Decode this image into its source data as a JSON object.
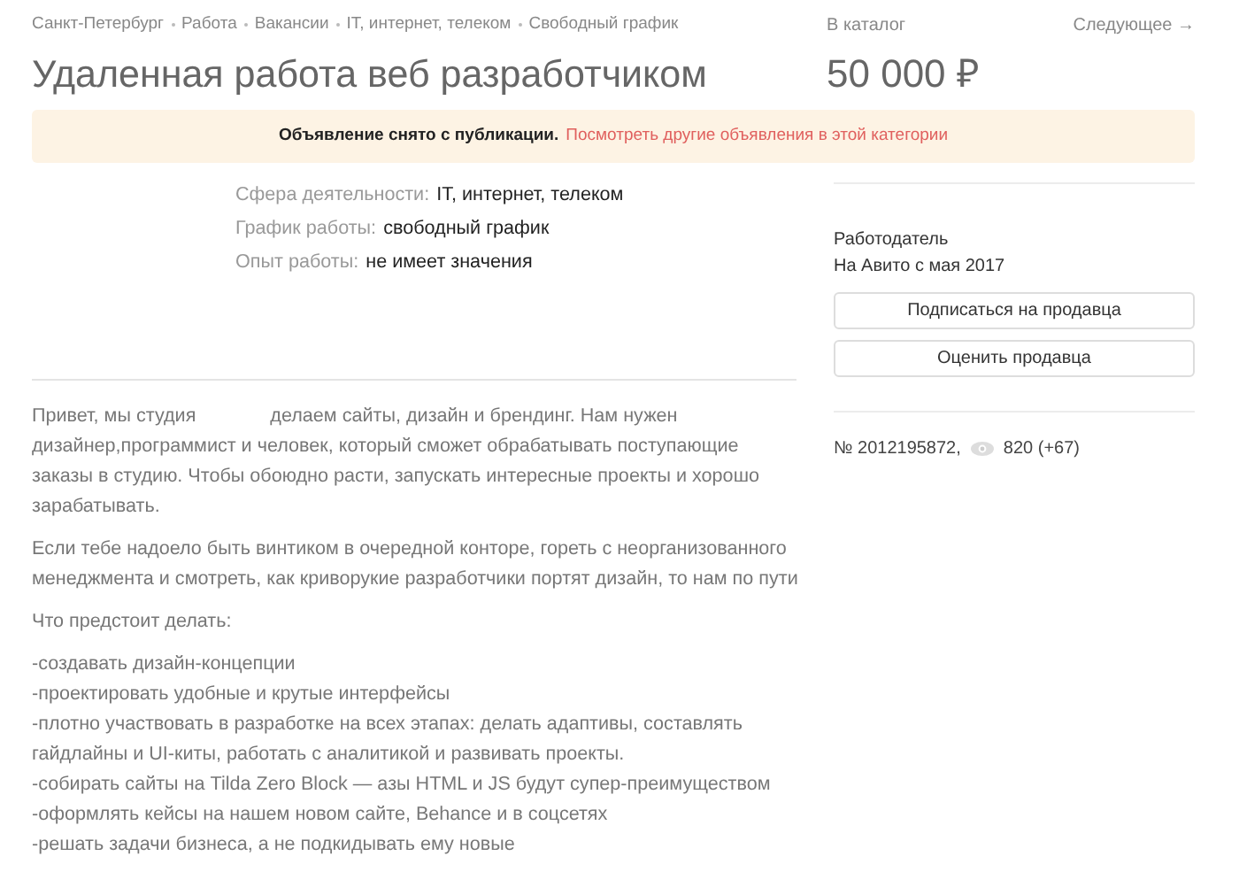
{
  "breadcrumbs": [
    "Санкт-Петербург",
    "Работа",
    "Вакансии",
    "IT, интернет, телеком",
    "Свободный график"
  ],
  "catalog_link": "В каталог",
  "next_link": "Следующее →",
  "title": "Удаленная работа веб разработчиком",
  "price": "50 000 ₽",
  "notice": {
    "message": "Объявление снято с публикации.",
    "link": "Посмотреть другие объявления в этой категории"
  },
  "params": [
    {
      "label": "Сфера деятельности:",
      "value": "IT, интернет, телеком"
    },
    {
      "label": "График работы:",
      "value": "свободный график"
    },
    {
      "label": "Опыт работы:",
      "value": "не имеет значения"
    }
  ],
  "seller": {
    "role": "Работодатель",
    "since": "На Авито с мая 2017"
  },
  "buttons": [
    "Подписаться на продавца",
    "Оценить продавца"
  ],
  "ad_number": "№ 2012195872,",
  "views": "820 (+67)",
  "intro": {
    "before": "Привет, мы студия",
    "after": "делаем сайты, дизайн и брендинг. Нам нужен дизайнер,программист и человек, который сможет обрабатывать поступающие заказы в студию. Чтобы обоюдно расти, запускать интересные проекты и хорошо зарабатывать."
  },
  "paragraphs": [
    "Если тебе надоело быть винтиком в очередной конторе, гореть с неорганизованного менеджмента и смотреть, как криворукие разработчики портят дизайн, то нам по пути",
    "Что предстоит делать:"
  ],
  "duties": [
    "-создавать дизайн-концепции",
    "-проектировать удобные и крутые интерфейсы",
    "-плотно участвовать в разработке на всех этапах: делать адаптивы, составлять гайдлайны и UI-киты, работать с аналитикой и развивать проекты.",
    "-собирать сайты на Tilda Zero Block — азы HTML и JS будут супер-преимуществом",
    "-оформлять кейсы на нашем новом сайте, Behance и в соцсетях",
    "-решать задачи бизнеса, а не подкидывать ему новые"
  ]
}
